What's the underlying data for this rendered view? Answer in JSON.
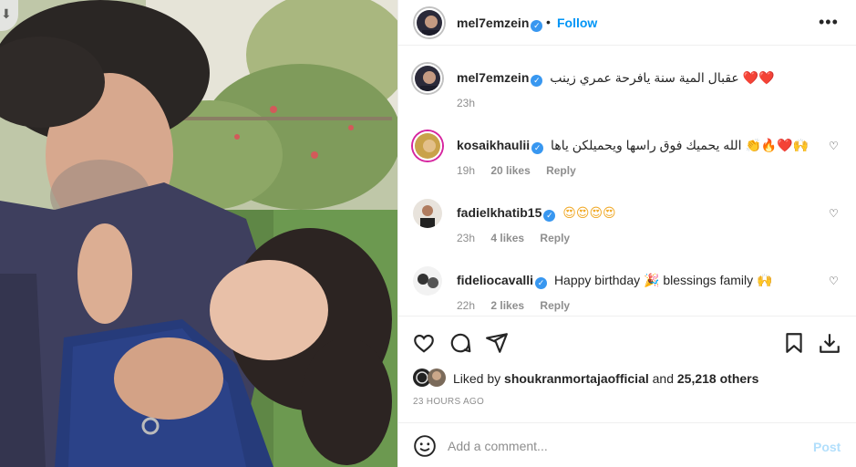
{
  "header": {
    "username": "mel7emzein",
    "separator": "•",
    "follow_label": "Follow",
    "more_label": "•••"
  },
  "caption": {
    "username": "mel7emzein",
    "text": "عقبال المية سنة يافرحة عمري زينب",
    "emoji": "❤️❤️",
    "time": "23h"
  },
  "comments": [
    {
      "username": "kosaikhaulii",
      "text": "الله يحميك فوق راسها ويحميلكن ياها",
      "emoji": "👏🔥❤️🙌",
      "time": "19h",
      "likes": "20 likes",
      "reply": "Reply"
    },
    {
      "username": "fadielkhatib15",
      "text": "",
      "emoji": "😍😍😍😍",
      "time": "23h",
      "likes": "4 likes",
      "reply": "Reply"
    },
    {
      "username": "fideliocavalli",
      "text": "Happy birthday 🎉 blessings family 🙌",
      "emoji": "",
      "time": "22h",
      "likes": "2 likes",
      "reply": "Reply"
    }
  ],
  "likes": {
    "prefix": "Liked by",
    "user": "shoukranmortajaofficial",
    "and": "and",
    "others": "25,218 others"
  },
  "timestamp": "23 HOURS AGO",
  "add_comment": {
    "placeholder": "Add a comment...",
    "post_label": "Post"
  },
  "icons": [
    "heart-icon",
    "comment-icon",
    "share-icon",
    "save-icon",
    "download-icon",
    "emoji-icon",
    "more-icon",
    "verified-icon"
  ],
  "colors": {
    "accent": "#0095f6",
    "verified": "#3897f0",
    "muted": "#8e8e8e",
    "post_disabled": "#b2dffc"
  }
}
